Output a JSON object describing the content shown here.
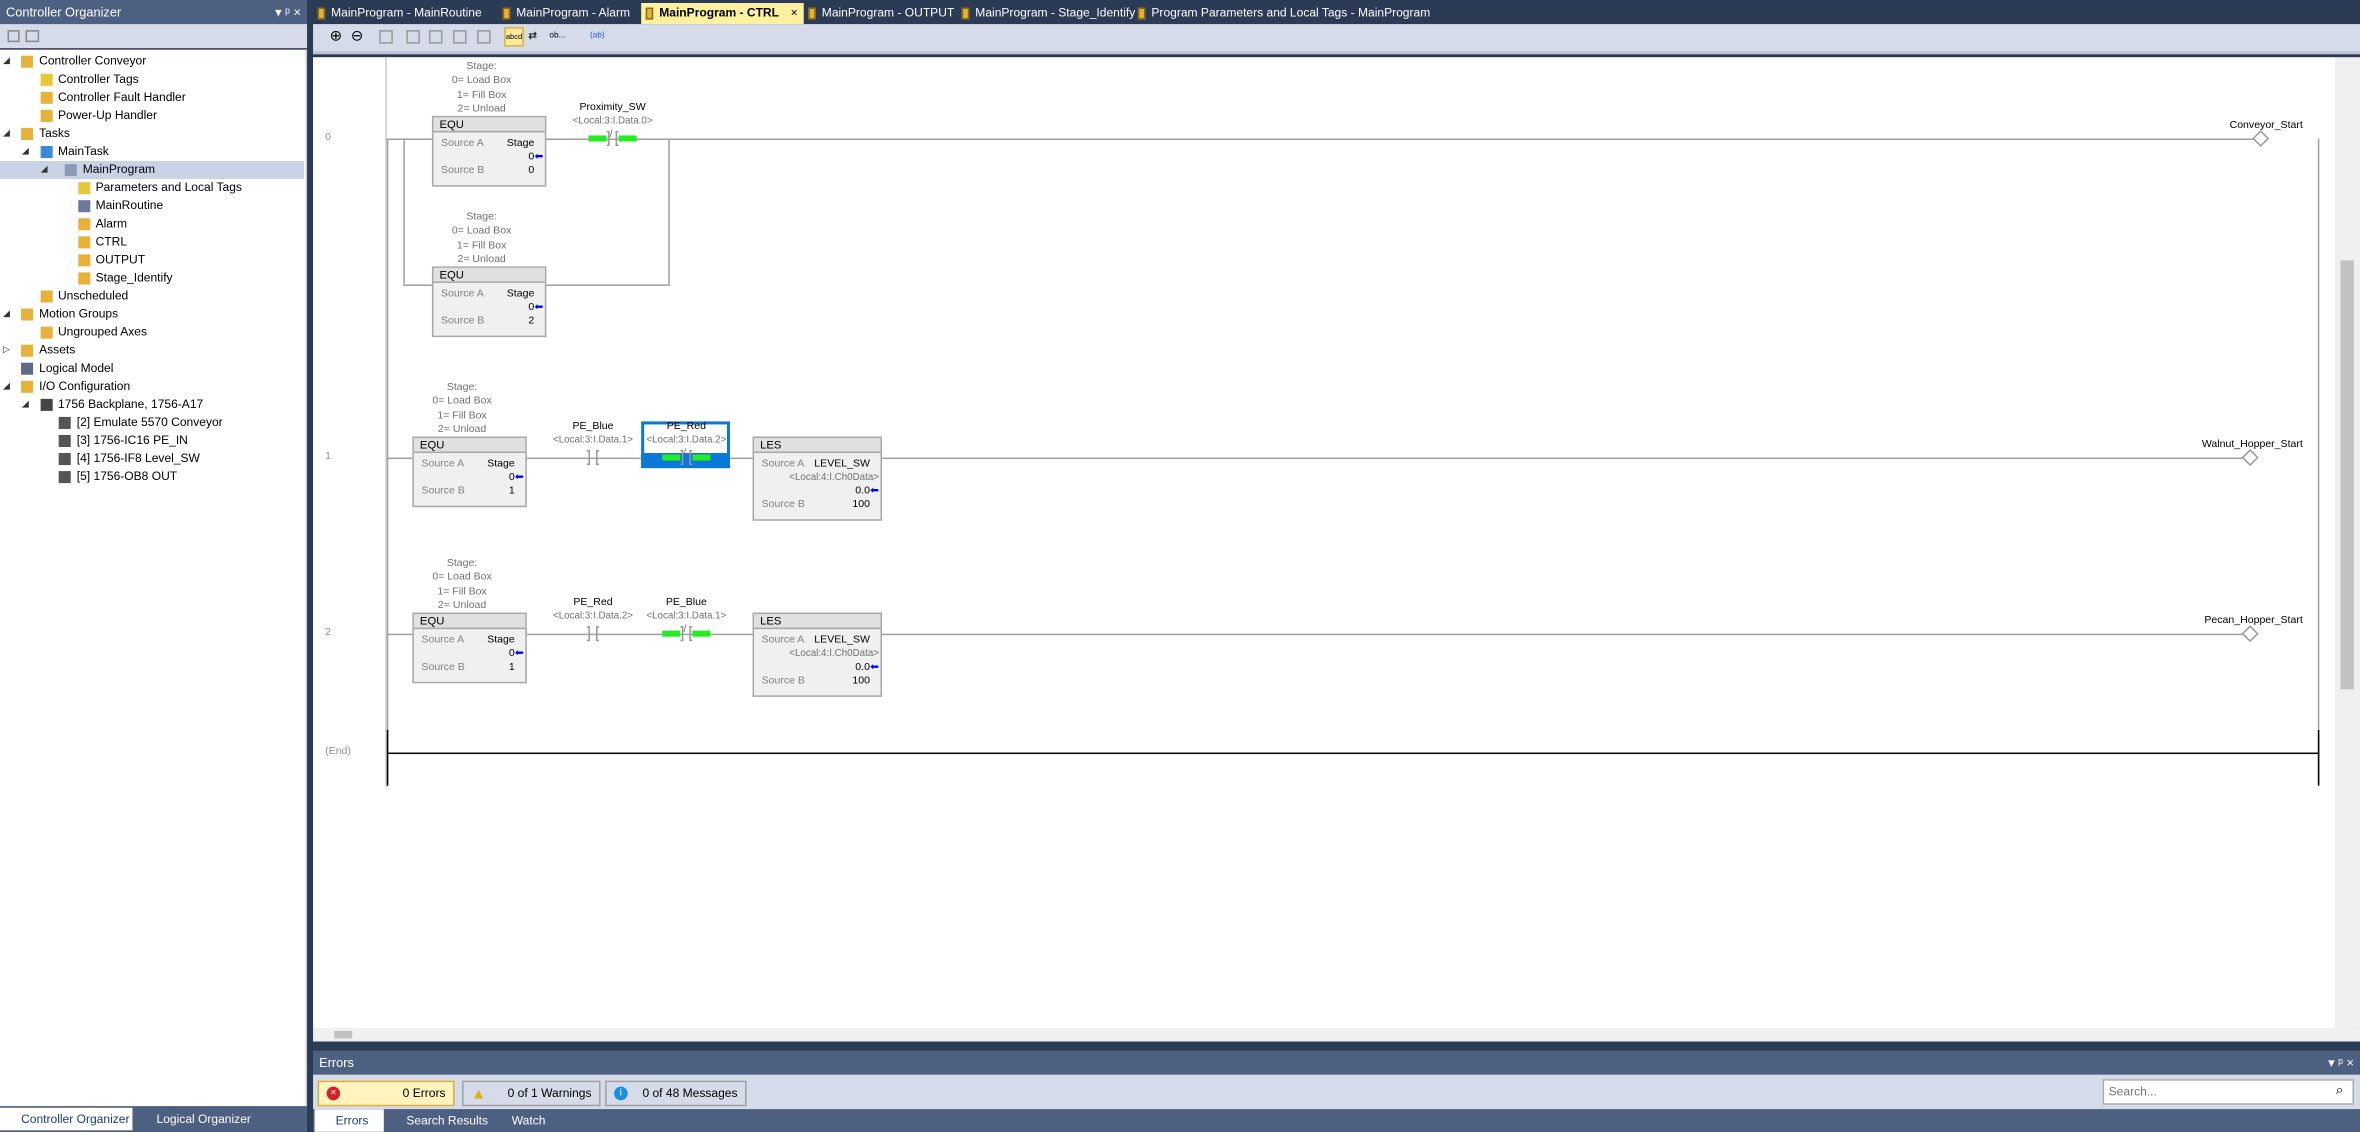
{
  "organizer": {
    "title": "Controller Organizer",
    "pin": "▾ ᵖ ×",
    "tree": [
      {
        "l": 0,
        "e": "open",
        "i": "folder",
        "t": "Controller Conveyor"
      },
      {
        "l": 1,
        "i": "tag",
        "t": "Controller Tags"
      },
      {
        "l": 1,
        "i": "folder",
        "t": "Controller Fault Handler"
      },
      {
        "l": 1,
        "i": "folder",
        "t": "Power-Up Handler"
      },
      {
        "l": 0,
        "e": "open",
        "i": "folder",
        "t": "Tasks"
      },
      {
        "l": 1,
        "e": "open",
        "i": "task",
        "t": "MainTask"
      },
      {
        "l": 2,
        "e": "open",
        "i": "program",
        "t": "MainProgram",
        "sel": true
      },
      {
        "l": 3,
        "i": "tag",
        "t": "Parameters and Local Tags"
      },
      {
        "l": 3,
        "i": "routine",
        "t": "MainRoutine"
      },
      {
        "l": 3,
        "i": "ladder",
        "t": "Alarm"
      },
      {
        "l": 3,
        "i": "ladder",
        "t": "CTRL"
      },
      {
        "l": 3,
        "i": "ladder",
        "t": "OUTPUT"
      },
      {
        "l": 3,
        "i": "ladder",
        "t": "Stage_Identify"
      },
      {
        "l": 1,
        "i": "folder",
        "t": "Unscheduled"
      },
      {
        "l": 0,
        "e": "open",
        "i": "folder",
        "t": "Motion Groups"
      },
      {
        "l": 1,
        "i": "folder",
        "t": "Ungrouped Axes"
      },
      {
        "l": 0,
        "e": "closed",
        "i": "folder",
        "t": "Assets"
      },
      {
        "l": 0,
        "i": "model",
        "t": "Logical Model"
      },
      {
        "l": 0,
        "e": "open",
        "i": "folder",
        "t": "I/O Configuration"
      },
      {
        "l": 1,
        "e": "open",
        "i": "backplane",
        "t": "1756 Backplane, 1756-A17"
      },
      {
        "l": 2,
        "i": "module",
        "t": "[2] Emulate 5570 Conveyor"
      },
      {
        "l": 2,
        "i": "module",
        "t": "[3] 1756-IC16 PE_IN"
      },
      {
        "l": 2,
        "i": "module",
        "t": "[4] 1756-IF8 Level_SW"
      },
      {
        "l": 2,
        "i": "module",
        "t": "[5] 1756-OB8 OUT"
      }
    ],
    "bottom_tabs": [
      "Controller Organizer",
      "Logical Organizer"
    ]
  },
  "tabs": [
    {
      "label": "MainProgram - MainRoutine"
    },
    {
      "label": "MainProgram - Alarm"
    },
    {
      "label": "MainProgram - CTRL",
      "active": true
    },
    {
      "label": "MainProgram - OUTPUT"
    },
    {
      "label": "MainProgram - Stage_Identify"
    },
    {
      "label": "Program Parameters and Local Tags - MainProgram"
    }
  ],
  "toolbar": {
    "abcd": "abcd",
    "ob": "ob...",
    "io": "(ab)"
  },
  "ladder": {
    "comment": [
      "Stage:",
      "0= Load Box",
      "1= Fill Box",
      "2= Unload"
    ],
    "end_label": "(End)",
    "rungs": [
      {
        "num": "0",
        "coil": "Conveyor_Start",
        "equs": [
          {
            "a": "Stage",
            "av": "0",
            "b": "0"
          },
          {
            "a": "Stage",
            "av": "0",
            "b": "2"
          }
        ],
        "contacts": [
          {
            "tag": "Proximity_SW",
            "addr": "<Local:3:I.Data.0>",
            "type": "XIO",
            "on": true
          }
        ]
      },
      {
        "num": "1",
        "coil": "Walnut_Hopper_Start",
        "equs": [
          {
            "a": "Stage",
            "av": "0",
            "b": "1"
          }
        ],
        "contacts": [
          {
            "tag": "PE_Blue",
            "addr": "<Local:3:I.Data.1>",
            "type": "XIC",
            "on": false
          },
          {
            "tag": "PE_Red",
            "addr": "<Local:3:I.Data.2>",
            "type": "XIO",
            "on": true,
            "sel": true
          }
        ],
        "les": {
          "title": "LES",
          "a": "LEVEL_SW",
          "addr": "<Local:4:I.Ch0Data>",
          "av": "0.0",
          "b": "100"
        }
      },
      {
        "num": "2",
        "coil": "Pecan_Hopper_Start",
        "equs": [
          {
            "a": "Stage",
            "av": "0",
            "b": "1"
          }
        ],
        "contacts": [
          {
            "tag": "PE_Red",
            "addr": "<Local:3:I.Data.2>",
            "type": "XIC",
            "on": false
          },
          {
            "tag": "PE_Blue",
            "addr": "<Local:3:I.Data.1>",
            "type": "XIO",
            "on": true
          }
        ],
        "les": {
          "title": "LES",
          "a": "LEVEL_SW",
          "addr": "<Local:4:I.Ch0Data>",
          "av": "0.0",
          "b": "100"
        }
      }
    ],
    "equ_title": "EQU",
    "source_a": "Source A",
    "source_b": "Source B"
  },
  "errors": {
    "title": "Errors",
    "errors": "0 Errors",
    "warnings": "0 of 1 Warnings",
    "messages": "0 of 48 Messages",
    "search_placeholder": "Search...",
    "tabs": [
      "Errors",
      "Search Results",
      "Watch"
    ]
  },
  "colors": {
    "energized": "#22ee22",
    "selection": "#0a78d7",
    "panel": "#4d6082"
  }
}
